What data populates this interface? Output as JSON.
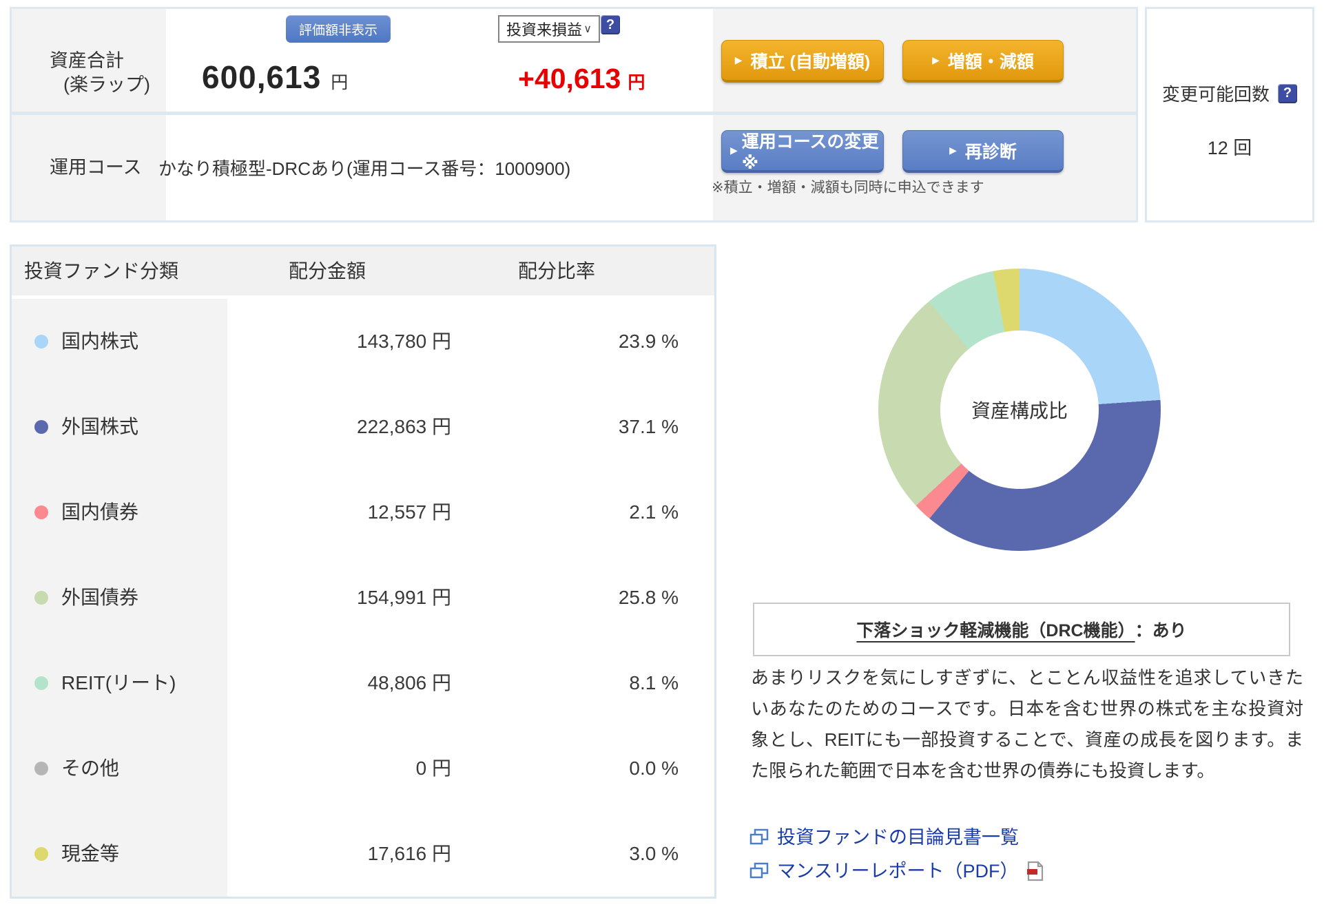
{
  "summary": {
    "asset_label_line1": "資産合計",
    "asset_label_line2": "(楽ラップ)",
    "hide_value_button": "評価額非表示",
    "total_value": "600,613",
    "total_unit": "円",
    "period_selector": {
      "selected": "投資来損益"
    },
    "gain_value": "+40,613",
    "gain_unit": "円",
    "help_icon": "?",
    "buttons": {
      "arrow": "▶",
      "tsumitate": "積立 (自動増額)",
      "zougaku": "増額・減額",
      "course_change": "運用コースの変更※",
      "rediagnosis": "再診断"
    },
    "course_label": "運用コース",
    "course_value": "かなり積極型-DRCあり(運用コース番号：1000900)",
    "note": "※積立・増額・減額も同時に申込できます",
    "change_count_label": "変更可能回数",
    "change_count_value": "12 回"
  },
  "allocation_table": {
    "headers": [
      "投資ファンド分類",
      "配分金額",
      "配分比率"
    ],
    "rows": [
      {
        "label": "国内株式",
        "amount": "143,780 円",
        "ratio": "23.9 %"
      },
      {
        "label": "外国株式",
        "amount": "222,863 円",
        "ratio": "37.1 %"
      },
      {
        "label": "国内債券",
        "amount": "12,557 円",
        "ratio": "2.1 %"
      },
      {
        "label": "外国債券",
        "amount": "154,991 円",
        "ratio": "25.8 %"
      },
      {
        "label": "REIT(リート)",
        "amount": "48,806 円",
        "ratio": "8.1 %"
      },
      {
        "label": "その他",
        "amount": "0 円",
        "ratio": "0.0 %"
      },
      {
        "label": "現金等",
        "amount": "17,616 円",
        "ratio": "3.0 %"
      }
    ]
  },
  "chart_data": {
    "type": "pie",
    "donut": true,
    "center_label": "資産構成比",
    "categories": [
      "国内株式",
      "外国株式",
      "国内債券",
      "外国債券",
      "REIT(リート)",
      "その他",
      "現金等"
    ],
    "values": [
      23.9,
      37.1,
      2.1,
      25.8,
      8.1,
      0.0,
      3.0
    ],
    "amounts_jpy": [
      143780,
      222863,
      12557,
      154991,
      48806,
      0,
      17616
    ],
    "colors": [
      "#a9d5f8",
      "#5a68ae",
      "#fa8a90",
      "#c8dab0",
      "#b4e3cc",
      "#b5b5b5",
      "#ded96e"
    ],
    "inner_radius_ratio": 0.56,
    "start_angle_deg": 0,
    "direction": "clockwise",
    "legend_position": "table-left"
  },
  "drc": {
    "title_underlined": "下落ショック軽減機能（DRC機能）",
    "title_suffix": "：あり",
    "description": "あまりリスクを気にしすぎずに、とことん収益性を追求していきたいあなたのためのコースです。日本を含む世界の株式を主な投資対象とし、REITにも一部投資することで、資産の成長を図ります。また限られた範囲で日本を含む世界の債券にも投資します。"
  },
  "links": [
    {
      "label": "投資ファンドの目論見書一覧",
      "has_pdf_icon": false
    },
    {
      "label": "マンスリーレポート（PDF）",
      "has_pdf_icon": true
    }
  ],
  "colors": {
    "accent_orange": "#e8a414",
    "action_blue": "#6186c8",
    "hide_button_blue": "#5b80c8",
    "gain_red": "#e60000",
    "link_blue": "#1a3caa",
    "panel_border": "#dde9f1",
    "cell_gray": "#f3f3f3",
    "help_navy": "#3d4da3"
  }
}
